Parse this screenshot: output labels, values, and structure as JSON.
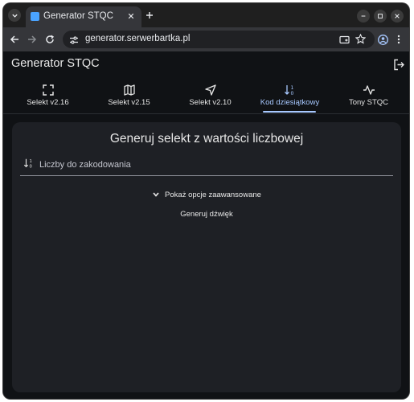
{
  "browser": {
    "tab_title": "Generator STQC",
    "url": "generator.serwerbartka.pl"
  },
  "app": {
    "title": "Generator STQC",
    "tabs": [
      {
        "label": "Selekt v2.16",
        "icon": "fullscreen-icon"
      },
      {
        "label": "Selekt v2.15",
        "icon": "map-icon"
      },
      {
        "label": "Selekt v2.10",
        "icon": "navigation-icon"
      },
      {
        "label": "Kod dziesiątkowy",
        "icon": "sort-numeric-icon",
        "active": true
      },
      {
        "label": "Tony STQC",
        "icon": "waveform-icon"
      }
    ]
  },
  "main": {
    "title": "Generuj selekt z wartości liczbowej",
    "input_placeholder": "Liczby do zakodowania",
    "input_value": "",
    "advanced_label": "Pokaż opcje zaawansowane",
    "generate_label": "Generuj dźwięk"
  },
  "colors": {
    "accent": "#a7c8ff",
    "background": "#101215",
    "card": "#1e2025"
  }
}
